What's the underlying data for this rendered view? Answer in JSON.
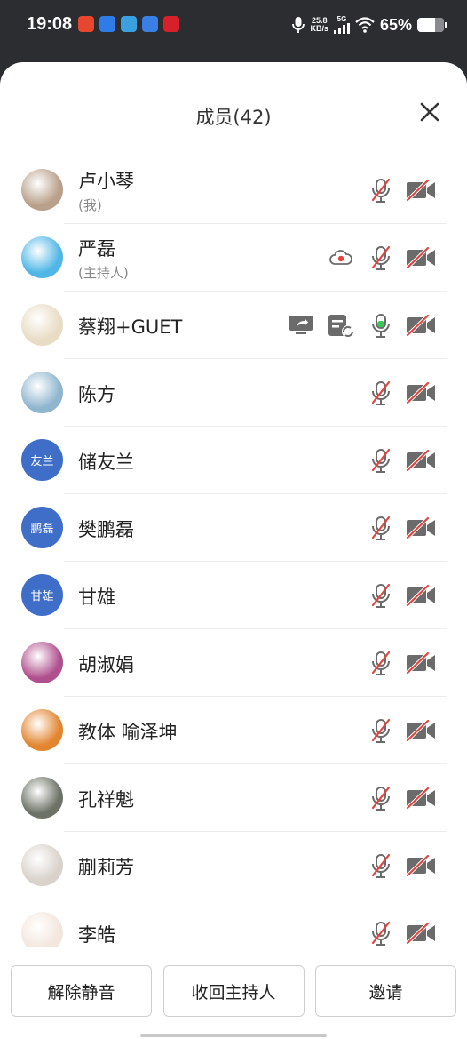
{
  "status_bar": {
    "time": "19:08",
    "net_speed_value": "25.8",
    "net_speed_unit": "KB/s",
    "network": "5G",
    "battery_percent": "65%",
    "battery_level": 0.65,
    "app_icon_colors": [
      "#e8472f",
      "#2f7be8",
      "#3aa0e0",
      "#3a7fe6",
      "#d8202a"
    ]
  },
  "sheet": {
    "title": "成员(42)",
    "close_icon": "close-icon"
  },
  "members": [
    {
      "name": "卢小琴",
      "subtitle": "(我)",
      "avatar_text": "",
      "avatar_color": "#b9a08a",
      "mic": "muted",
      "cam": "off"
    },
    {
      "name": "严磊",
      "subtitle": "(主持人)",
      "avatar_text": "",
      "avatar_color": "#4fb6e6",
      "mic": "muted",
      "cam": "off",
      "extra": [
        "cloud-record-icon"
      ]
    },
    {
      "name": "蔡翔+GUET",
      "subtitle": "",
      "avatar_text": "",
      "avatar_color": "#e8dcc4",
      "mic": "active",
      "cam": "off",
      "extra": [
        "screen-share-icon",
        "document-icon"
      ]
    },
    {
      "name": "陈方",
      "subtitle": "",
      "avatar_text": "",
      "avatar_color": "#8fb6cf",
      "mic": "muted",
      "cam": "off"
    },
    {
      "name": "储友兰",
      "subtitle": "",
      "avatar_text": "友兰",
      "avatar_color": "#3e6ec8",
      "mic": "muted",
      "cam": "off"
    },
    {
      "name": "樊鹏磊",
      "subtitle": "",
      "avatar_text": "鹏磊",
      "avatar_color": "#3e6ec8",
      "mic": "muted",
      "cam": "off"
    },
    {
      "name": "甘雄",
      "subtitle": "",
      "avatar_text": "甘雄",
      "avatar_color": "#3e6ec8",
      "mic": "muted",
      "cam": "off"
    },
    {
      "name": "胡淑娟",
      "subtitle": "",
      "avatar_text": "",
      "avatar_color": "#b04f8e",
      "mic": "muted",
      "cam": "off"
    },
    {
      "name": "教体 喻泽坤",
      "subtitle": "",
      "avatar_text": "",
      "avatar_color": "#e2852f",
      "mic": "muted",
      "cam": "off"
    },
    {
      "name": "孔祥魁",
      "subtitle": "",
      "avatar_text": "",
      "avatar_color": "#6c7266",
      "mic": "muted",
      "cam": "off"
    },
    {
      "name": "蒯莉芳",
      "subtitle": "",
      "avatar_text": "",
      "avatar_color": "#d9d2cb",
      "mic": "muted",
      "cam": "off"
    },
    {
      "name": "李皓",
      "subtitle": "",
      "avatar_text": "",
      "avatar_color": "#f3e6dd",
      "mic": "muted",
      "cam": "off"
    }
  ],
  "buttons": {
    "unmute_all": "解除静音",
    "reclaim_host": "收回主持人",
    "invite": "邀请"
  },
  "colors": {
    "muted_red": "#e0453e",
    "icon_gray": "#6b6b6b",
    "mic_active_green": "#3cc653",
    "avatar_blue": "#3e6ec8"
  }
}
